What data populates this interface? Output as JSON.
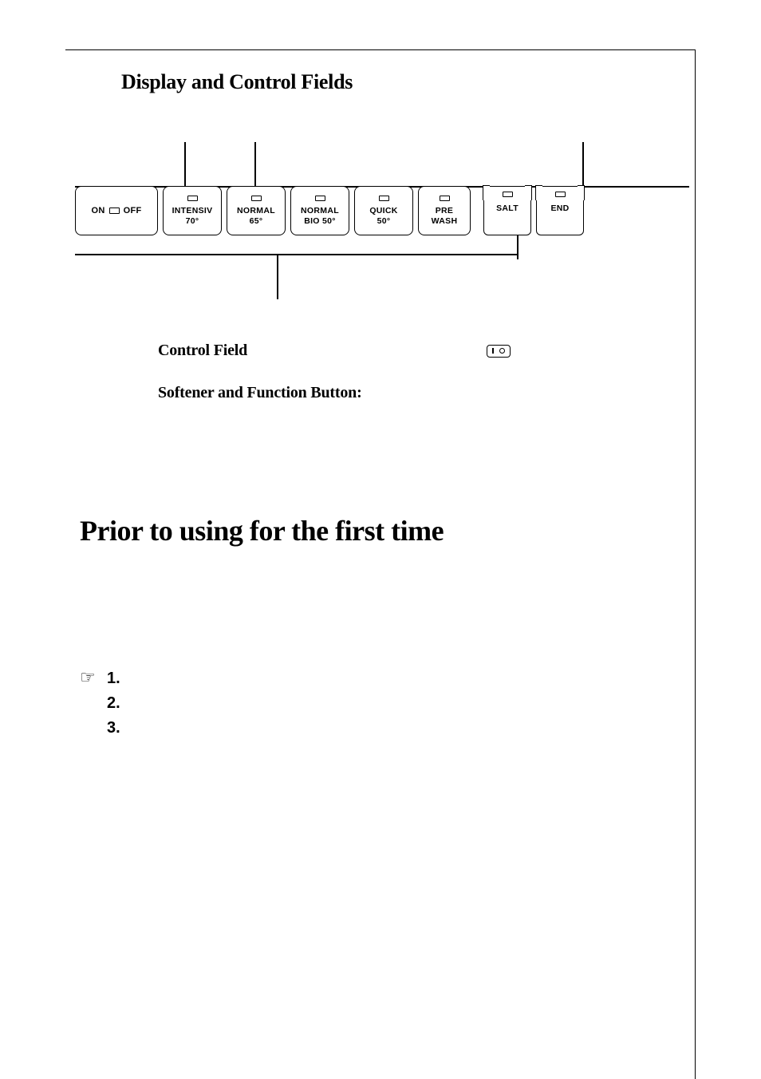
{
  "headings": {
    "display_control": "Display and Control Fields",
    "control_field": "Control Field",
    "softener_button": "Softener and Function Button:",
    "prior_use": "Prior to using for the first time"
  },
  "panel": {
    "onoff": {
      "on": "ON",
      "off": "OFF"
    },
    "programs": [
      {
        "line1": "INTENSIV",
        "line2": "70°"
      },
      {
        "line1": "NORMAL",
        "line2": "65°"
      },
      {
        "line1": "NORMAL",
        "line2": "BIO 50°"
      },
      {
        "line1": "QUICK",
        "line2": "50°"
      },
      {
        "line1": "PRE",
        "line2": "WASH"
      }
    ],
    "indicators": [
      {
        "label": "SALT"
      },
      {
        "label": "END"
      }
    ]
  },
  "steps": [
    {
      "num": "1."
    },
    {
      "num": "2."
    },
    {
      "num": "3."
    }
  ],
  "icons": {
    "pointing_hand": "☞"
  }
}
